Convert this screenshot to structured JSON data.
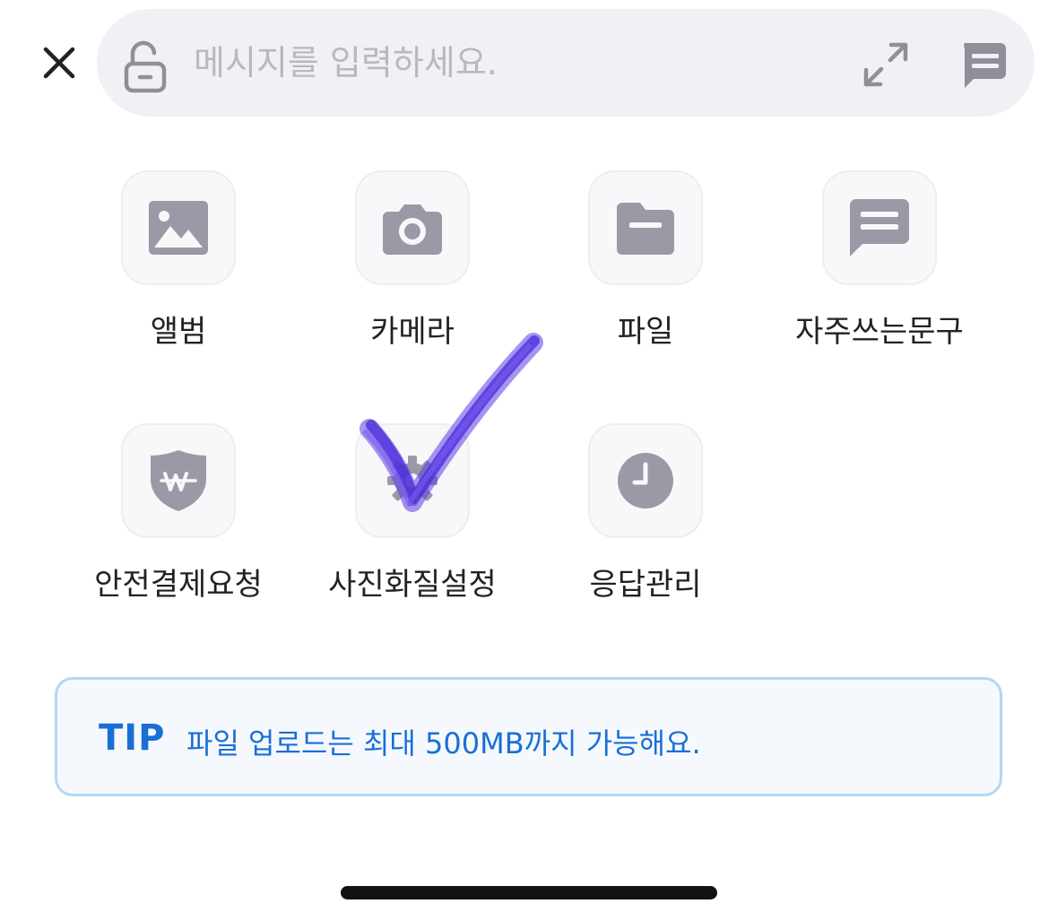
{
  "composer": {
    "placeholder": "메시지를 입력하세요.",
    "icons": [
      "close-icon",
      "lock-open-icon",
      "expand-icon",
      "message-template-icon"
    ]
  },
  "actions": [
    {
      "label": "앨범",
      "icon": "image-icon"
    },
    {
      "label": "카메라",
      "icon": "camera-icon"
    },
    {
      "label": "파일",
      "icon": "folder-icon"
    },
    {
      "label": "자주쓰는문구",
      "icon": "message-icon"
    },
    {
      "label": "안전결제요청",
      "icon": "shield-won-icon"
    },
    {
      "label": "사진화질설정",
      "icon": "gear-icon"
    },
    {
      "label": "응답관리",
      "icon": "clock-icon"
    }
  ],
  "tip": {
    "label": "TIP",
    "text": "파일 업로드는 최대 500MB까지 가능해요."
  },
  "colors": {
    "icon_gray": "#9a9aa6",
    "tip_blue": "#1a6fd4",
    "tip_border": "#b6d6f5",
    "checkmark": "#5b3de6"
  }
}
